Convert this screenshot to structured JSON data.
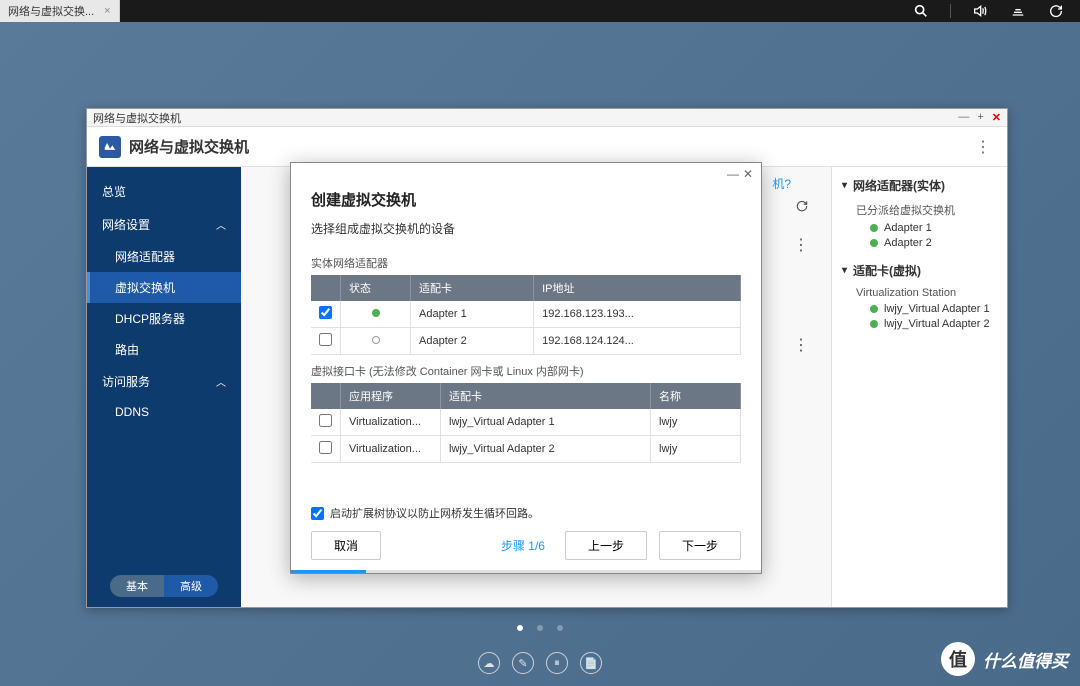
{
  "taskbar": {
    "tab_label": "网络与虚拟交换..."
  },
  "window": {
    "title": "网络与虚拟交换机"
  },
  "app": {
    "title": "网络与虚拟交换机"
  },
  "sidebar": {
    "overview": "总览",
    "network_settings": "网络设置",
    "adapter": "网络适配器",
    "vswitch": "虚拟交换机",
    "dhcp": "DHCP服务器",
    "route": "路由",
    "access_service": "访问服务",
    "ddns": "DDNS",
    "basic": "基本",
    "advanced": "高级"
  },
  "main": {
    "help_suffix": "机?"
  },
  "right": {
    "physical_title": "网络适配器(实体)",
    "assigned_label": "已分派给虚拟交换机",
    "adapter1": "Adapter 1",
    "adapter2": "Adapter 2",
    "virtual_title": "适配卡(虚拟)",
    "vs_label": "Virtualization Station",
    "va1": "lwjy_Virtual Adapter 1",
    "va2": "lwjy_Virtual Adapter 2"
  },
  "modal": {
    "title": "创建虚拟交换机",
    "subtitle": "选择组成虚拟交换机的设备",
    "phys_label": "实体网络适配器",
    "cols": {
      "status": "状态",
      "adapter": "适配卡",
      "ip": "IP地址",
      "app": "应用程序",
      "name": "名称"
    },
    "phys_rows": [
      {
        "checked": true,
        "on": true,
        "adapter": "Adapter 1",
        "ip": "192.168.123.193..."
      },
      {
        "checked": false,
        "on": false,
        "adapter": "Adapter 2",
        "ip": "192.168.124.124..."
      }
    ],
    "virt_label": "虚拟接口卡 (无法修改 Container 网卡或 Linux 内部网卡)",
    "virt_rows": [
      {
        "checked": false,
        "app": "Virtualization...",
        "adapter": "lwjy_Virtual Adapter 1",
        "name": "lwjy"
      },
      {
        "checked": false,
        "app": "Virtualization...",
        "adapter": "lwjy_Virtual Adapter 2",
        "name": "lwjy"
      }
    ],
    "stp_label": "启动扩展树协议以防止网桥发生循环回路。",
    "cancel": "取消",
    "step": "步骤 1/6",
    "prev": "上一步",
    "next": "下一步"
  },
  "watermark": {
    "text": "什么值得买",
    "badge": "值"
  }
}
